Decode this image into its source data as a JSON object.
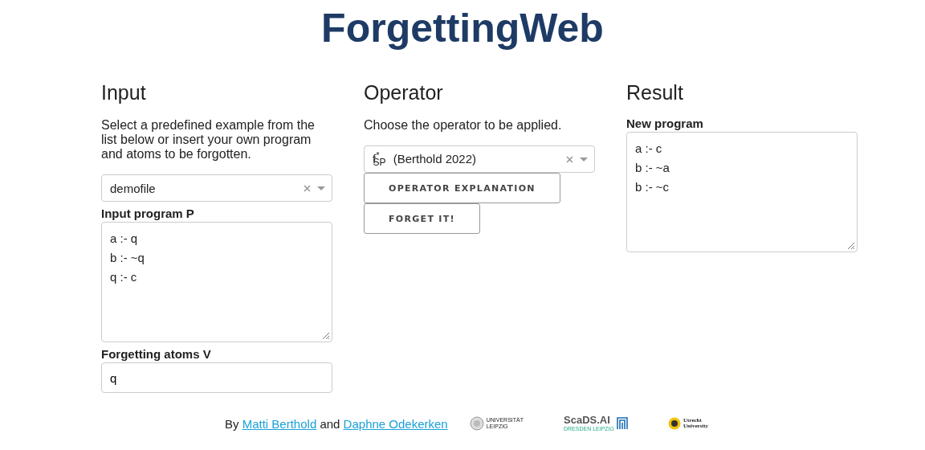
{
  "title": "ForgettingWeb",
  "input": {
    "heading": "Input",
    "description": "Select a predefined example from the list below or insert your own program and atoms to be forgotten.",
    "example_select": {
      "value": "demofile"
    },
    "program_label": "Input program P",
    "program_lines": [
      "a :- q",
      "b :- ~q",
      "q :- c"
    ],
    "atoms_label": "Forgetting atoms V",
    "atoms_value": "q"
  },
  "operator": {
    "heading": "Operator",
    "description": "Choose the operator to be applied.",
    "operator_select": {
      "value": "f$^{*}$$_{SP}$ (Berthold 2022)"
    },
    "buttons": [
      "OPERATOR EXPLANATION",
      "FORGET IT!"
    ]
  },
  "result": {
    "heading": "Result",
    "program_label": "New program",
    "program_lines": [
      "a :- c",
      "b :- ~a",
      "b :- ~c"
    ]
  },
  "footer": {
    "prefix": "By",
    "links": [
      "Matti Berthold",
      "Daphne Odekerken"
    ],
    "joiner": "and",
    "logos": [
      {
        "kind": "seal",
        "lines": [
          "UNIVERSITÄT",
          "LEIPZIG"
        ]
      },
      {
        "kind": "bars",
        "lines": [
          "ScaDS.AI",
          "DRESDEN LEIPZIG"
        ]
      },
      {
        "kind": "sun",
        "lines": [
          "Utrecht",
          "University"
        ]
      }
    ]
  }
}
